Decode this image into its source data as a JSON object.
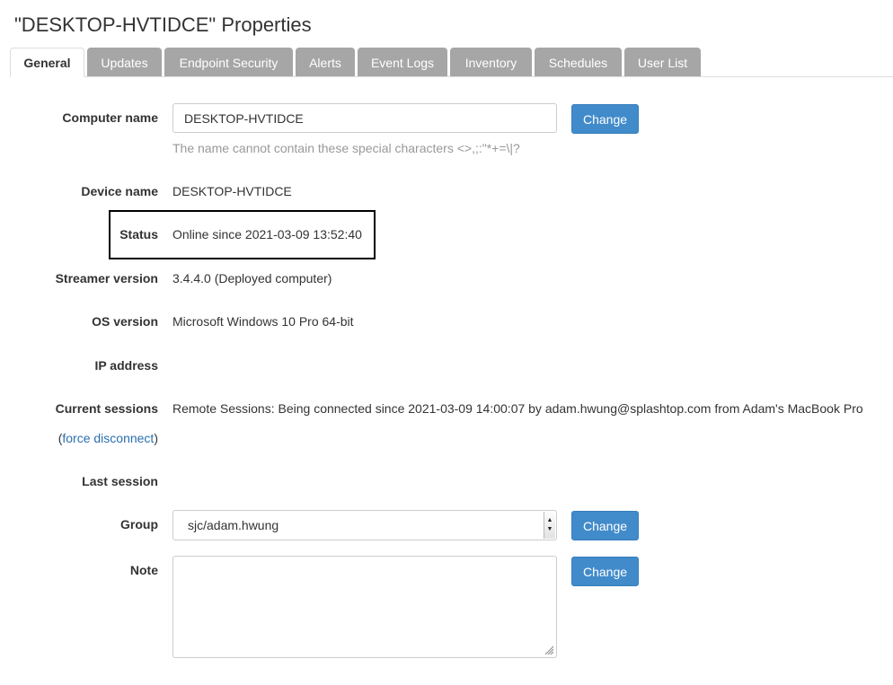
{
  "title": "\"DESKTOP-HVTIDCE\" Properties",
  "tabs": [
    {
      "label": "General",
      "active": true
    },
    {
      "label": "Updates"
    },
    {
      "label": "Endpoint Security"
    },
    {
      "label": "Alerts"
    },
    {
      "label": "Event Logs"
    },
    {
      "label": "Inventory"
    },
    {
      "label": "Schedules"
    },
    {
      "label": "User List"
    }
  ],
  "colors": {
    "tab_inactive": "#a6a6a6",
    "button": "#428bca",
    "link": "#2a6fb0",
    "hint": "#999999"
  },
  "form": {
    "computer_name": {
      "label": "Computer name",
      "value": "DESKTOP-HVTIDCE",
      "hint": "The name cannot contain these special characters <>,;:\"*+=\\|?",
      "button": "Change"
    },
    "device_name": {
      "label": "Device name",
      "value": "DESKTOP-HVTIDCE"
    },
    "status": {
      "label": "Status",
      "value": "Online since 2021-03-09 13:52:40"
    },
    "streamer_version": {
      "label": "Streamer version",
      "value": "3.4.4.0 (Deployed computer)"
    },
    "os_version": {
      "label": "OS version",
      "value": "Microsoft Windows 10 Pro 64-bit"
    },
    "ip_address": {
      "label": "IP address",
      "value": ""
    },
    "current_sessions": {
      "label": "Current sessions",
      "value": "Remote Sessions: Being connected since 2021-03-09 14:00:07 by adam.hwung@splashtop.com from Adam's MacBook Pro",
      "open_paren": "(",
      "link": "force disconnect",
      "close_paren": ")"
    },
    "last_session": {
      "label": "Last session",
      "value": ""
    },
    "group": {
      "label": "Group",
      "value": "sjc/adam.hwung",
      "button": "Change",
      "arrow_icon": "select-arrow-icon"
    },
    "note": {
      "label": "Note",
      "value": "",
      "button": "Change",
      "resize_icon": "resize-grip-icon"
    }
  }
}
